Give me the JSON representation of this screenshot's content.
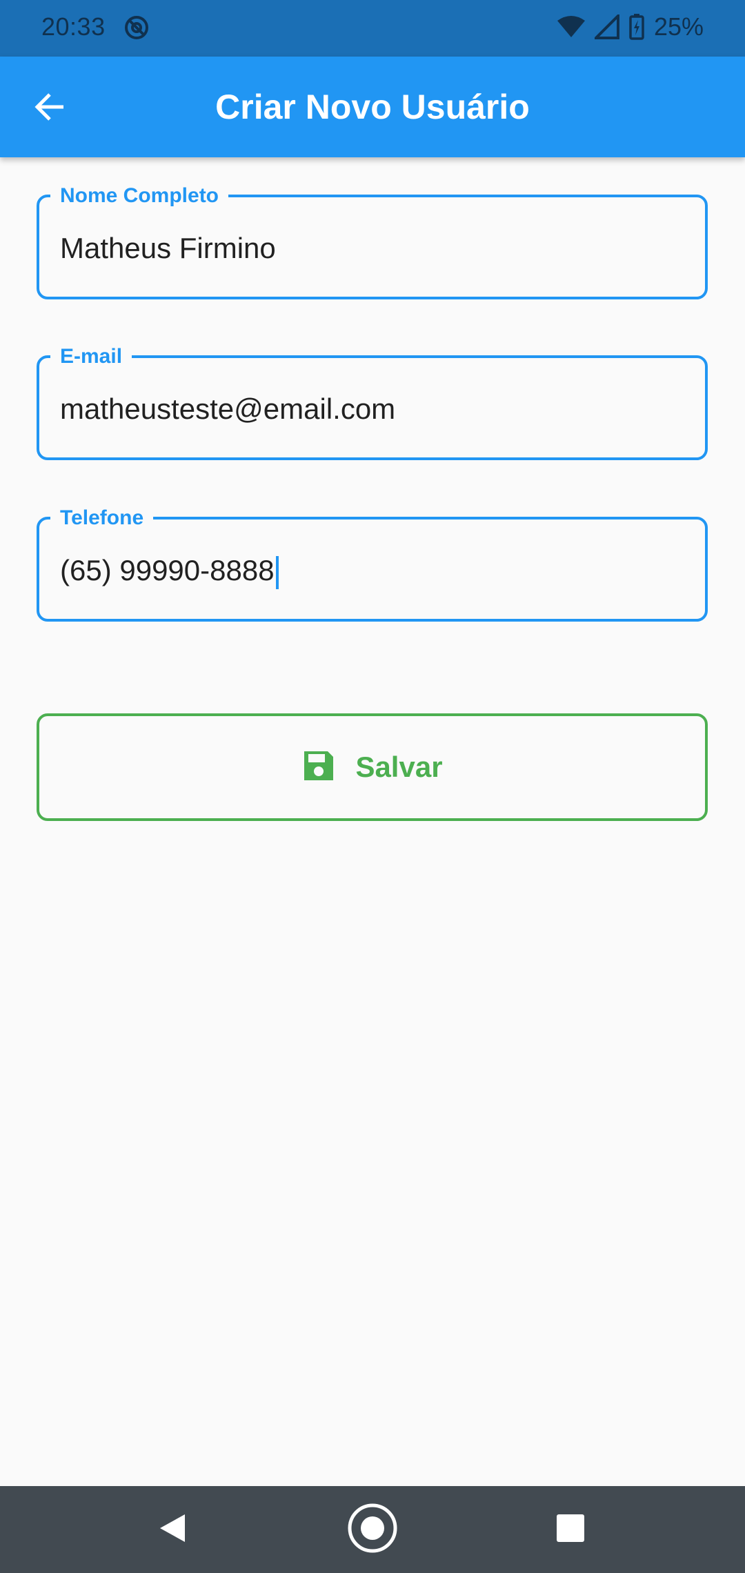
{
  "status_bar": {
    "time": "20:33",
    "battery": "25%",
    "icons": [
      "dnd-icon",
      "wifi-icon",
      "signal-icon",
      "battery-charging-icon"
    ]
  },
  "app_bar": {
    "title": "Criar Novo Usuário",
    "back_icon": "arrow-left-icon"
  },
  "form": {
    "name": {
      "label": "Nome Completo",
      "value": "Matheus Firmino"
    },
    "email": {
      "label": "E-mail",
      "value": "matheusteste@email.com"
    },
    "phone": {
      "label": "Telefone",
      "value": "(65) 99990-8888"
    }
  },
  "save_button": {
    "label": "Salvar",
    "icon": "floppy-disk-icon"
  },
  "colors": {
    "primary": "#2196f3",
    "status_bar": "#1b6fb5",
    "success": "#4caf50",
    "background": "#fafafa",
    "nav_bar": "#424a51"
  },
  "nav_bar": {
    "buttons": [
      "back-triangle-icon",
      "home-circle-icon",
      "recents-square-icon"
    ]
  }
}
